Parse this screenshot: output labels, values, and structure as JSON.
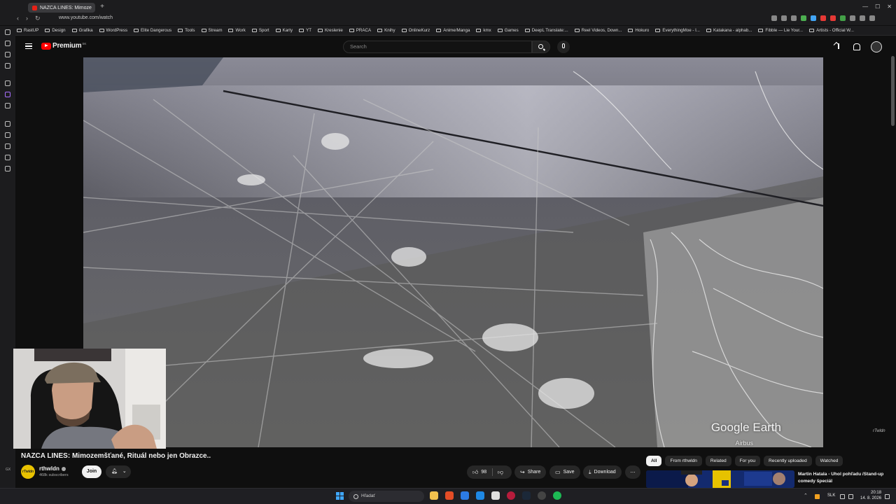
{
  "browser": {
    "tab_title": "NAZCA LINES: Mimoze",
    "url": "www.youtube.com/watch",
    "bookmarks": [
      "RastUP",
      "Design",
      "Grafika",
      "WordPress",
      "Elite Dangerous",
      "Tools",
      "Stream",
      "Work",
      "Sport",
      "Karty",
      "YT",
      "Kreslenie",
      "PRACA",
      "Knihy",
      "OnlineKurz",
      "Anime/Manga",
      "kmx",
      "Games",
      "DeepL Translate:...",
      "Reel Videos, Down...",
      "Hokuro",
      "EverythingMoe - I...",
      "Katakana - alphab...",
      "Fibble — Lie Your...",
      "Artists - Official W..."
    ]
  },
  "youtube": {
    "logo_text": "Premium",
    "logo_country": "SK",
    "search_placeholder": "Search"
  },
  "video": {
    "overlay_brand": "Google Earth",
    "overlay_credit": "Airbus",
    "channel_watermark": "rTwldn",
    "title": "NAZCA LINES: Mimozemšťané, Rituál nebo jen Obrazce..",
    "channel_name": "rthwldn",
    "channel_avatar_text": "rTwldn",
    "subscribers": "468k subscribers",
    "join_label": "Join",
    "like_count": "98",
    "share_label": "Share",
    "save_label": "Save",
    "download_label": "Download",
    "left_footer": "GX"
  },
  "sidebar_chips": [
    "All",
    "From rthwldn",
    "Related",
    "For you",
    "Recently uploaded",
    "Watched"
  ],
  "recommendation": {
    "title": "Martin Hatala - Uhol pohľadu /Stand-up comedy špeciál"
  },
  "taskbar": {
    "search_text": "Hľadať",
    "language": "SLK",
    "time": "20:18",
    "date": "14. 8. 2026"
  },
  "colors": {
    "youtube_red": "#ff0000",
    "background": "#0f0f0f"
  }
}
